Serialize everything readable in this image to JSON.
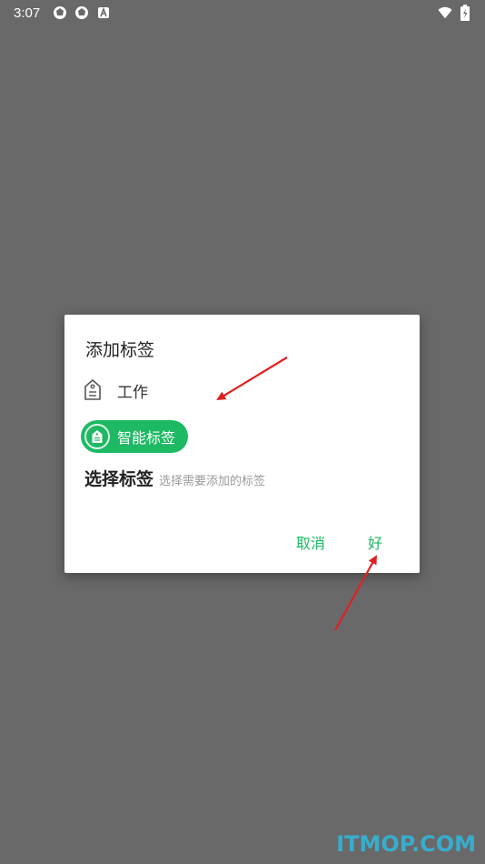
{
  "status_bar": {
    "time": "3:07",
    "left_icons": [
      "aperture-icon",
      "aperture-icon",
      "text-a-icon"
    ],
    "right_icons": [
      "wifi-icon",
      "battery-charging-icon"
    ]
  },
  "dialog": {
    "title": "添加标签",
    "tag": {
      "label": "工作",
      "icon": "tag-icon"
    },
    "smart_chip": {
      "label": "智能标签",
      "icon": "tag-icon",
      "color": "#1DB963"
    },
    "select": {
      "title": "选择标签",
      "hint": "选择需要添加的标签"
    },
    "actions": {
      "cancel": "取消",
      "ok": "好"
    }
  },
  "colors": {
    "backdrop": "#696969",
    "accent": "#1DB963",
    "annotation_arrow": "#E02020",
    "watermark": "#2FB9E0"
  },
  "watermark": "ITMOP.COM"
}
